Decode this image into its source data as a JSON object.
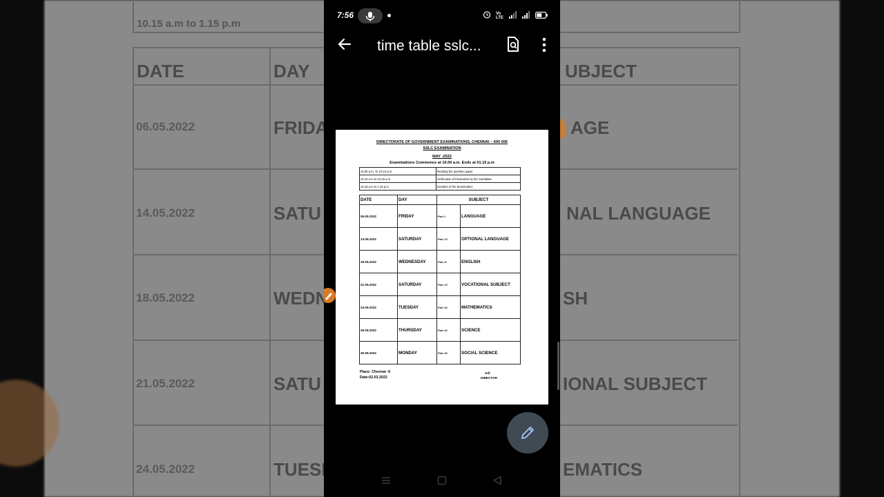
{
  "status_bar": {
    "time": "7:56",
    "network_label": "Vo LTE"
  },
  "app_bar": {
    "title": "time table sslc..."
  },
  "document": {
    "heading1": "DIRECTORATE OF GOVERNMENT EXAMINATIONS, CHENNAI – 600 006",
    "heading2": "SSLC EXAMINATION",
    "heading3": "MAY -2022",
    "heading4": "Examinations Commence at 10.00 a.m. Ends at 01.15 p.m",
    "schedule": [
      {
        "time": "10.00 a.m. To 10.10 a.m",
        "activity": "Reading the question paper"
      },
      {
        "time": "10.10 a.m to 10.15 a.m",
        "activity": "Verification of Particulars by the Candidate"
      },
      {
        "time": "10.15 a.m to 1.15 p.m",
        "activity": "Duration of the Examination"
      }
    ],
    "columns": {
      "date": "DATE",
      "day": "DAY",
      "subject": "SUBJECT"
    },
    "rows": [
      {
        "date": "06.05.2022",
        "day": "FRIDAY",
        "part": "Part -I",
        "subject": "LANGUAGE"
      },
      {
        "date": "14.05.2022",
        "day": "SATURDAY",
        "part": "Part -IV",
        "subject": "OPTIONAL LANGUAGE"
      },
      {
        "date": "18.05.2022",
        "day": "WEDNESDAY",
        "part": "Part -II",
        "subject": "ENGLISH"
      },
      {
        "date": "21.05.2022",
        "day": "SATURDAY",
        "part": "Part -IV",
        "subject": "VOCATIONAL SUBJECT"
      },
      {
        "date": "24.05.2022",
        "day": "TUESDAY",
        "part": "Part -III",
        "subject": "MATHEMATICS"
      },
      {
        "date": "26.05.2022",
        "day": "THURSDAY",
        "part": "Part -III",
        "subject": "SCIENCE"
      },
      {
        "date": "30.05.2022",
        "day": "MONDAY",
        "part": "Part -III",
        "subject": "SOCIAL SCIENCE"
      }
    ],
    "place": "Place: Chennai -6",
    "date": "Date:02.03.2022",
    "signature": "Sd/-",
    "signatory": "DIRECTOR"
  },
  "background": {
    "top_text": "10.15 a.m to 1.15 p.m",
    "header_date": "DATE",
    "header_day": "DAY",
    "header_subject_fragment": "UBJECT",
    "rows": [
      {
        "date": "06.05.2022",
        "day": "FRIDA",
        "subject": "AGE"
      },
      {
        "date": "14.05.2022",
        "day": "SATU",
        "subject": "NAL LANGUAGE"
      },
      {
        "date": "18.05.2022",
        "day": "WEDN",
        "subject": "SH"
      },
      {
        "date": "21.05.2022",
        "day": "SATU",
        "subject": "IONAL SUBJECT"
      },
      {
        "date": "24.05.2022",
        "day": "TUESD",
        "subject": "EMATICS"
      }
    ]
  },
  "icons": {
    "back": "arrow-left-icon",
    "search_doc": "find-in-page-icon",
    "more": "more-vert-icon",
    "edit": "pencil-icon",
    "mic": "mic-icon",
    "nav_menu": "menu-icon",
    "nav_home": "square-icon",
    "nav_back": "triangle-icon"
  },
  "colors": {
    "fab": "#3f4a52",
    "accent_orange": "#d77a28"
  }
}
